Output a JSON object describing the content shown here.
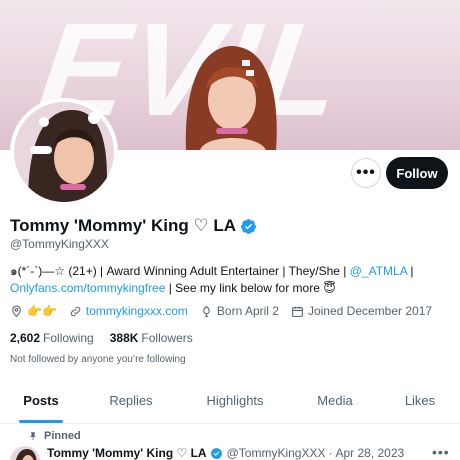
{
  "banner": {
    "word": "EVIL"
  },
  "profile": {
    "name": "Tommy 'Mommy' King ♡ LA",
    "handle": "@TommyKingXXX",
    "bio_prefix": "๑(*´-`)—☆ (21+) | Award Winning Adult Entertainer | They/She | ",
    "bio_mention": "@_ATMLA",
    "bio_sep": " |",
    "bio_link": "Onlyfans.com/tommykingfree",
    "bio_suffix": " | See my link below for more 😇",
    "location": "👉👉",
    "website": "tommykingxxx.com",
    "born": "Born April 2",
    "joined": "Joined December 2017",
    "following_count": "2,602",
    "following_label": "Following",
    "followers_count": "388K",
    "followers_label": "Followers",
    "not_followed": "Not followed by anyone you’re following"
  },
  "actions": {
    "more": "•••",
    "follow": "Follow"
  },
  "tabs": [
    {
      "label": "Posts",
      "active": true
    },
    {
      "label": "Replies"
    },
    {
      "label": "Highlights"
    },
    {
      "label": "Media"
    },
    {
      "label": "Likes"
    }
  ],
  "pinned_tweet": {
    "pinned_label": "Pinned",
    "name": "Tommy 'Mommy' King ♡ LA",
    "handle_date": "@TommyKingXXX · Apr 28, 2023",
    "more": "•••"
  },
  "colors": {
    "accent": "#1d9bf0",
    "text": "#0f1419",
    "muted": "#536471"
  },
  "icons": [
    "location-icon",
    "link-icon",
    "birthday-icon",
    "calendar-icon",
    "verified-icon",
    "pin-icon"
  ]
}
